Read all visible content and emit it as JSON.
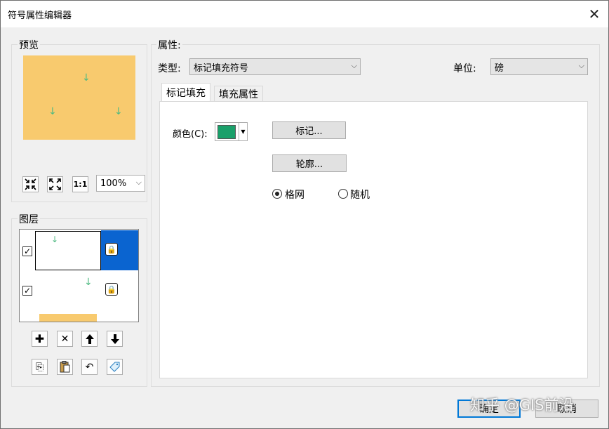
{
  "window": {
    "title": "符号属性编辑器",
    "close_glyph": "✕"
  },
  "preview_group": {
    "label": "预览",
    "zoom_value": "100%",
    "zoom_icon_text": "1:1",
    "fill_color": "#f8ca6e",
    "marker_color": "#4fba82",
    "marker_glyph": "↓"
  },
  "layers_group": {
    "label": "图层",
    "items": [
      {
        "checked": true,
        "selected": true,
        "marker": "↓",
        "lock_glyph": "🔒"
      },
      {
        "checked": true,
        "selected": false,
        "marker": "↓",
        "lock_glyph": "🔒"
      }
    ],
    "check_glyph": "✓",
    "toolbar": {
      "add": "✚",
      "remove": "✕",
      "up": "🡅",
      "down": "🡇"
    },
    "toolbar2": {
      "copy": "⎘",
      "paste": "📋",
      "undo": "↶",
      "tag": "◇"
    }
  },
  "properties": {
    "label": "属性:",
    "type_label": "类型:",
    "type_value": "标记填充符号",
    "unit_label": "单位:",
    "unit_value": "磅"
  },
  "tabs": [
    {
      "label": "标记填充",
      "active": true
    },
    {
      "label": "填充属性",
      "active": false
    }
  ],
  "marker_fill": {
    "color_label": "颜色(C):",
    "color_hex": "#1aa06a",
    "marker_button": "标记...",
    "outline_button": "轮廓...",
    "radio_grid": "格网",
    "radio_random": "随机",
    "selected": "grid"
  },
  "footer": {
    "ok": "确定",
    "cancel": "取消",
    "watermark": "知乎 @GIS前沿"
  }
}
